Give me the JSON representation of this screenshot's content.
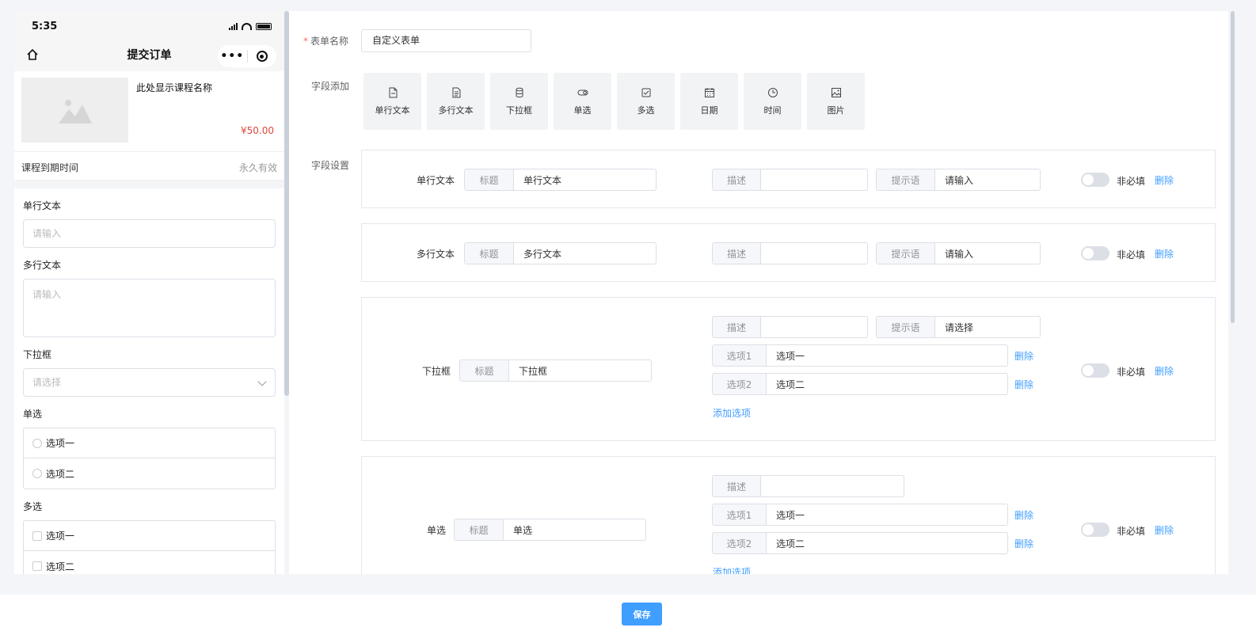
{
  "preview": {
    "status_time": "5:35",
    "nav_title": "提交订单",
    "course_name": "此处显示课程名称",
    "course_price": "¥50.00",
    "expire_label": "课程到期时间",
    "expire_value": "永久有效",
    "fields": {
      "single_label": "单行文本",
      "single_placeholder": "请输入",
      "multi_label": "多行文本",
      "multi_placeholder": "请输入",
      "select_label": "下拉框",
      "select_placeholder": "请选择",
      "radio_label": "单选",
      "radio_options": [
        "选项一",
        "选项二"
      ],
      "check_label": "多选",
      "check_options": [
        "选项一",
        "选项二"
      ]
    }
  },
  "editor": {
    "form_name_label": "表单名称",
    "form_name_value": "自定义表单",
    "field_add_label": "字段添加",
    "field_settings_label": "字段设置",
    "field_buttons": [
      {
        "label": "单行文本",
        "icon": "file-icon"
      },
      {
        "label": "多行文本",
        "icon": "document-icon"
      },
      {
        "label": "下拉框",
        "icon": "database-icon"
      },
      {
        "label": "单选",
        "icon": "toggle-icon"
      },
      {
        "label": "多选",
        "icon": "checkbox-icon"
      },
      {
        "label": "日期",
        "icon": "calendar-icon"
      },
      {
        "label": "时间",
        "icon": "clock-icon"
      },
      {
        "label": "图片",
        "icon": "picture-icon"
      }
    ],
    "common": {
      "title_prefix": "标题",
      "desc_prefix": "描述",
      "hint_prefix": "提示语",
      "optional_text": "非必填",
      "delete_text": "删除",
      "add_option_text": "添加选项"
    },
    "cards": [
      {
        "name": "单行文本",
        "title_value": "单行文本",
        "desc_value": "",
        "hint_value": "请输入"
      },
      {
        "name": "多行文本",
        "title_value": "多行文本",
        "desc_value": "",
        "hint_value": "请输入"
      },
      {
        "name": "下拉框",
        "title_value": "下拉框",
        "desc_value": "",
        "hint_value": "请选择",
        "options": [
          {
            "label": "选项1",
            "value": "选项一"
          },
          {
            "label": "选项2",
            "value": "选项二"
          }
        ]
      },
      {
        "name": "单选",
        "title_value": "单选",
        "desc_value": "",
        "options": [
          {
            "label": "选项1",
            "value": "选项一"
          },
          {
            "label": "选项2",
            "value": "选项二"
          }
        ]
      }
    ]
  },
  "save_label": "保存",
  "colors": {
    "primary": "#409eff",
    "price": "#e0473b",
    "required": "#f56c6c"
  }
}
